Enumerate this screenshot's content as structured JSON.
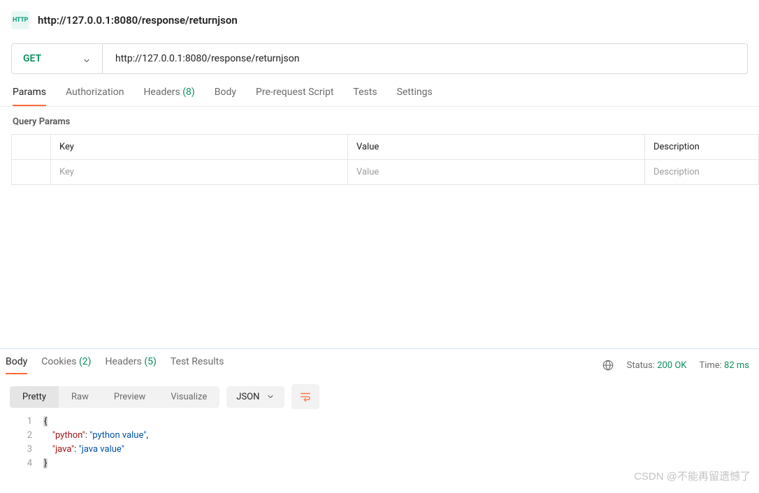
{
  "title": {
    "url_text": "http://127.0.0.1:8080/response/returnjson",
    "icon_label": "HTTP"
  },
  "request": {
    "method": "GET",
    "url": "http://127.0.0.1:8080/response/returnjson",
    "tabs": {
      "params": "Params",
      "auth": "Authorization",
      "headers": "Headers",
      "headers_count": "(8)",
      "body": "Body",
      "prerequest": "Pre-request Script",
      "tests": "Tests",
      "settings": "Settings"
    },
    "query_section_label": "Query Params",
    "columns": {
      "key": "Key",
      "value": "Value",
      "desc": "Description"
    },
    "placeholders": {
      "key": "Key",
      "value": "Value",
      "desc": "Description"
    }
  },
  "response": {
    "tabs": {
      "body": "Body",
      "cookies": "Cookies",
      "cookies_count": "(2)",
      "headers": "Headers",
      "headers_count": "(5)",
      "test_results": "Test Results"
    },
    "status_label": "Status:",
    "status_value": "200 OK",
    "time_label": "Time:",
    "time_value": "82 ms",
    "view_modes": {
      "pretty": "Pretty",
      "raw": "Raw",
      "preview": "Preview",
      "visualize": "Visualize"
    },
    "format": "JSON",
    "body_lines": [
      {
        "n": "1",
        "type": "brace",
        "text": "{"
      },
      {
        "n": "2",
        "indent": "    ",
        "key": "\"python\"",
        "sep": ": ",
        "val": "\"python value\"",
        "trail": ","
      },
      {
        "n": "3",
        "indent": "    ",
        "key": "\"java\"",
        "sep": ": ",
        "val": "\"java value\"",
        "trail": ""
      },
      {
        "n": "4",
        "type": "brace",
        "text": "}"
      }
    ]
  },
  "watermark": "CSDN @不能再留遗憾了"
}
